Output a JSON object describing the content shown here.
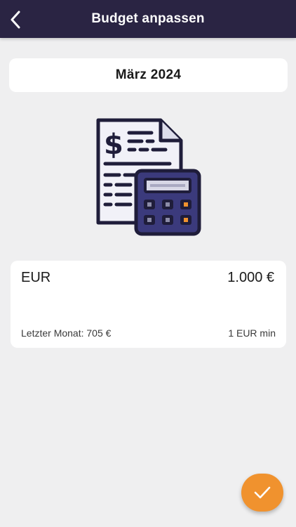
{
  "header": {
    "title": "Budget anpassen",
    "back_icon": "chevron-left-icon",
    "background": "#2a2443"
  },
  "month": {
    "label": "März 2024"
  },
  "illustration": {
    "icon": "budget-document-calculator-icon",
    "dollar_sign": "$",
    "colors": {
      "outline": "#1f1d3a",
      "paper": "#f1f1f8",
      "calculator": "#3b3a7c",
      "screen": "#d7d7e6",
      "key_orange": "#f0922e"
    }
  },
  "budget": {
    "currency": "EUR",
    "amount": "1.000 €",
    "last_month": "Letzter Monat: 705 €",
    "min_label": "1 EUR min"
  },
  "fab": {
    "icon": "checkmark-icon",
    "color": "#f0922e"
  }
}
